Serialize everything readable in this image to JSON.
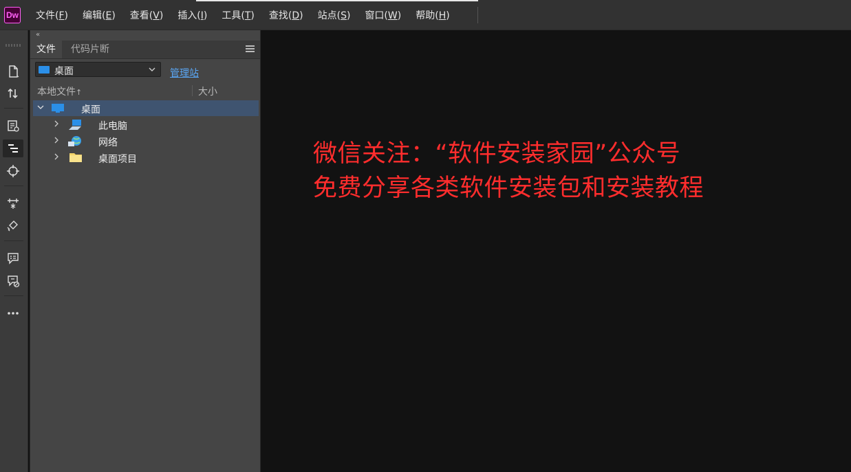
{
  "app": {
    "logo_text": "Dw",
    "accent": "#ff61f6",
    "logo_bg": "#470137"
  },
  "menu": [
    {
      "label": "文件(",
      "key": "F",
      "suffix": ")"
    },
    {
      "label": "编辑(",
      "key": "E",
      "suffix": ")"
    },
    {
      "label": "查看(",
      "key": "V",
      "suffix": ")"
    },
    {
      "label": "插入(",
      "key": "I",
      "suffix": ")"
    },
    {
      "label": "工具(",
      "key": "T",
      "suffix": ")"
    },
    {
      "label": "查找(",
      "key": "D",
      "suffix": ")"
    },
    {
      "label": "站点(",
      "key": "S",
      "suffix": ")"
    },
    {
      "label": "窗口(",
      "key": "W",
      "suffix": ")"
    },
    {
      "label": "帮助(",
      "key": "H",
      "suffix": ")"
    }
  ],
  "toolbar_icons": [
    "new-document-icon",
    "file-transfer-icon",
    "live-view-icon",
    "code-align-icon",
    "target-icon",
    "dom-tool-icon",
    "brush-code-icon",
    "comment-icon",
    "comment-remove-icon",
    "more-icon"
  ],
  "panel": {
    "collapse_glyph": "«",
    "tabs": [
      "文件",
      "代码片断"
    ],
    "site_select": "桌面",
    "manage_link": "管理站",
    "col_local": "本地文件",
    "col_sort_arrow": "↑",
    "col_size": "大小",
    "tree": [
      {
        "label": "桌面",
        "icon": "desktop-icon",
        "expanded": true,
        "selected": true
      },
      {
        "label": "此电脑",
        "icon": "computer-icon",
        "expanded": false
      },
      {
        "label": "网络",
        "icon": "network-icon",
        "expanded": false
      },
      {
        "label": "桌面项目",
        "icon": "folder-icon",
        "expanded": false
      }
    ]
  },
  "watermark": {
    "line1": "微信关注：“软件安装家园”公众号",
    "line2": "免费分享各类软件安装包和安装教程",
    "color": "#ff2d2d"
  },
  "colors": {
    "selected_row": "#3f5470",
    "link": "#5aa7f5"
  }
}
